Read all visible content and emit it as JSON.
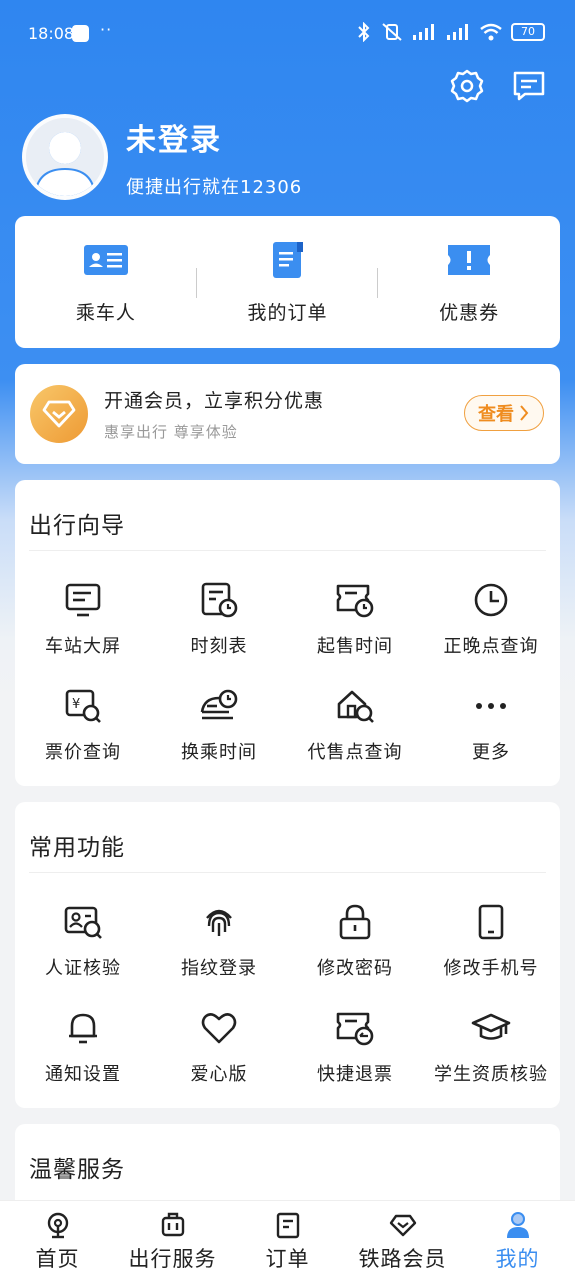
{
  "status": {
    "time": "18:08",
    "dots": "··",
    "battery": "70"
  },
  "profile": {
    "name": "未登录",
    "subtitle": "便捷出行就在12306"
  },
  "quick": [
    {
      "label": "乘车人",
      "icon": "id-card-icon"
    },
    {
      "label": "我的订单",
      "icon": "order-doc-icon"
    },
    {
      "label": "优惠券",
      "icon": "coupon-icon"
    }
  ],
  "member": {
    "title": "开通会员，立享积分优惠",
    "subtitle": "惠享出行 尊享体验",
    "button": "查看"
  },
  "guide": {
    "title": "出行向导",
    "items": [
      {
        "label": "车站大屏",
        "icon": "station-screen-icon"
      },
      {
        "label": "时刻表",
        "icon": "timetable-icon"
      },
      {
        "label": "起售时间",
        "icon": "sale-time-icon"
      },
      {
        "label": "正晚点查询",
        "icon": "clock-icon"
      },
      {
        "label": "票价查询",
        "icon": "fare-search-icon"
      },
      {
        "label": "换乘时间",
        "icon": "transfer-time-icon"
      },
      {
        "label": "代售点查询",
        "icon": "agency-search-icon"
      },
      {
        "label": "更多",
        "icon": "more-icon"
      }
    ]
  },
  "common": {
    "title": "常用功能",
    "items": [
      {
        "label": "人证核验",
        "icon": "id-verify-icon"
      },
      {
        "label": "指纹登录",
        "icon": "fingerprint-icon"
      },
      {
        "label": "修改密码",
        "icon": "lock-icon"
      },
      {
        "label": "修改手机号",
        "icon": "phone-icon"
      },
      {
        "label": "通知设置",
        "icon": "bell-icon"
      },
      {
        "label": "爱心版",
        "icon": "heart-icon"
      },
      {
        "label": "快捷退票",
        "icon": "refund-ticket-icon"
      },
      {
        "label": "学生资质核验",
        "icon": "graduation-cap-icon"
      }
    ]
  },
  "warm": {
    "title": "温馨服务"
  },
  "tabs": [
    {
      "label": "首页",
      "icon": "home-icon"
    },
    {
      "label": "出行服务",
      "icon": "luggage-icon"
    },
    {
      "label": "订单",
      "icon": "order-icon"
    },
    {
      "label": "铁路会员",
      "icon": "diamond-icon"
    },
    {
      "label": "我的",
      "icon": "person-icon"
    }
  ],
  "colors": {
    "primary": "#3b8ef0",
    "member_orange": "#ef8c1f"
  }
}
